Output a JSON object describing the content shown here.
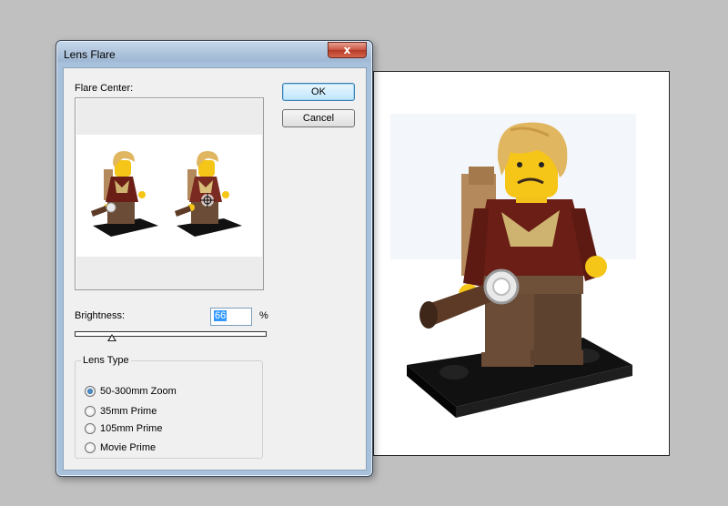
{
  "dialog": {
    "title": "Lens Flare",
    "close_label": "x",
    "flare_center_label": "Flare Center:",
    "ok_label": "OK",
    "cancel_label": "Cancel",
    "brightness_label": "Brightness:",
    "brightness_value": "66",
    "percent_label": "%",
    "lens_type_label": "Lens Type",
    "lens_types": [
      "50-300mm Zoom",
      "35mm Prime",
      "105mm Prime",
      "Movie Prime"
    ],
    "selected_lens": "50-300mm Zoom"
  },
  "colors": {
    "desktop": "#c0c0c0",
    "dialog_frame": "#a7c0db",
    "close_button": "#c75440",
    "selection": "#3399ff"
  }
}
